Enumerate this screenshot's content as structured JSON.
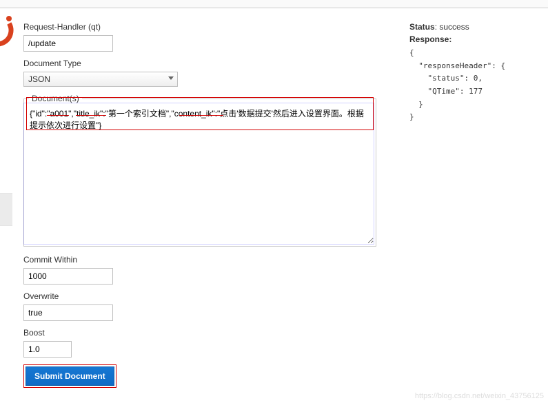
{
  "form": {
    "request_handler": {
      "label": "Request-Handler (qt)",
      "value": "/update"
    },
    "document_type": {
      "label": "Document Type",
      "value": "JSON"
    },
    "documents": {
      "legend": "Document(s)",
      "value": "{\"id\":\"a001\",\"title_ik\":\"第一个索引文档\",\"content_ik\":\"点击'数据提交'然后进入设置界面。根据提示依次进行设置\"}"
    },
    "commit_within": {
      "label": "Commit Within",
      "value": "1000"
    },
    "overwrite": {
      "label": "Overwrite",
      "value": "true"
    },
    "boost": {
      "label": "Boost",
      "value": "1.0"
    },
    "submit_label": "Submit Document"
  },
  "response": {
    "status_label": "Status",
    "status_value": "success",
    "response_label": "Response:",
    "body": "{\n  \"responseHeader\": {\n    \"status\": 0,\n    \"QTime\": 177\n  }\n}"
  },
  "watermark": "https://blog.csdn.net/weixin_43756125",
  "highlights": {
    "keys": [
      "id",
      "title_ik",
      "content_ik"
    ]
  }
}
